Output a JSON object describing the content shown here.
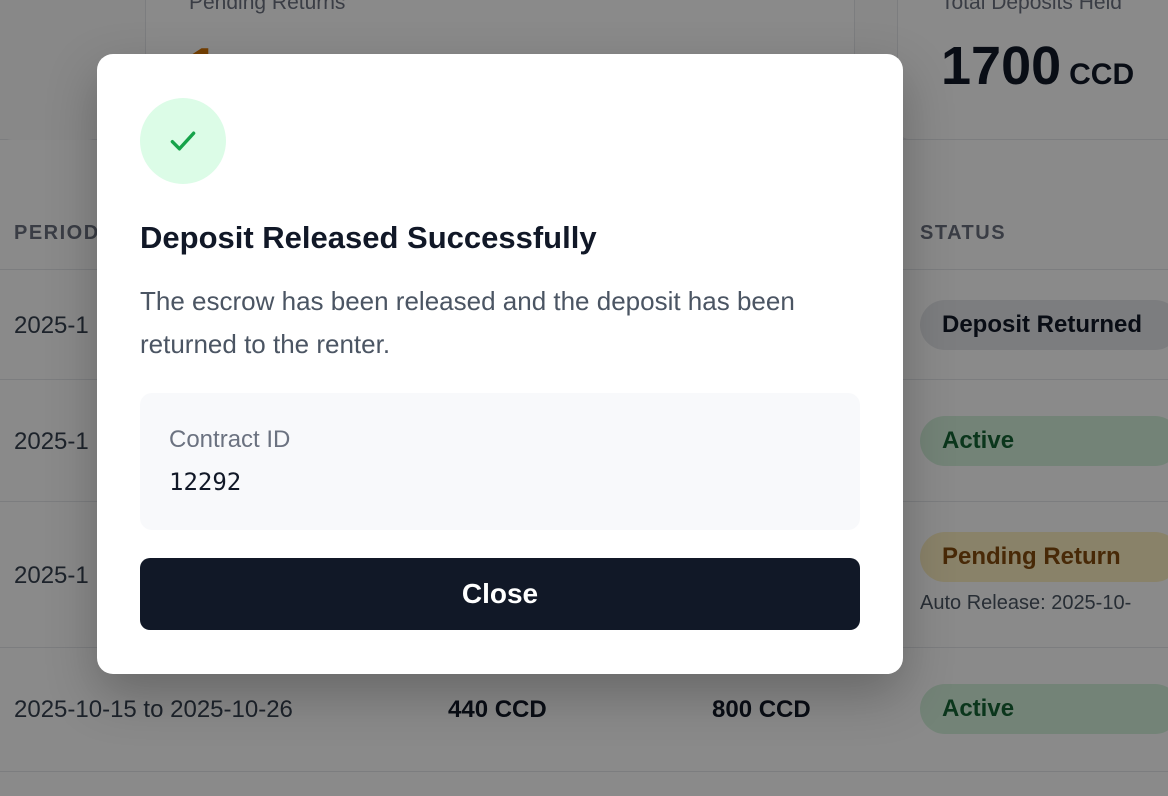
{
  "colors": {
    "overlay": "rgba(0,0,0,0.46)",
    "success_icon": "#16a34a",
    "button_bg": "#111827"
  },
  "stats": {
    "pending_label": "Pending Returns",
    "pending_value": "1",
    "deposits_label": "Total Deposits Held",
    "deposits_value": "1700",
    "deposits_unit": "CCD"
  },
  "table": {
    "headers": {
      "period": "PERIOD",
      "status": "STATUS"
    },
    "rows": [
      {
        "period": "2025-1",
        "status": "Deposit Returned"
      },
      {
        "period": "2025-1",
        "status": "Active"
      },
      {
        "period": "2025-1",
        "status": "Pending Return",
        "note": "Auto Release: 2025-10-"
      },
      {
        "period": "2025-10-15 to 2025-10-26",
        "rent": "440 CCD",
        "deposit": "800 CCD",
        "status": "Active"
      }
    ]
  },
  "modal": {
    "icon": "check-icon",
    "title": "Deposit Released Successfully",
    "message": "The escrow has been released and the deposit has been returned to the renter.",
    "contract_label": "Contract ID",
    "contract_id": "12292",
    "close_label": "Close"
  }
}
